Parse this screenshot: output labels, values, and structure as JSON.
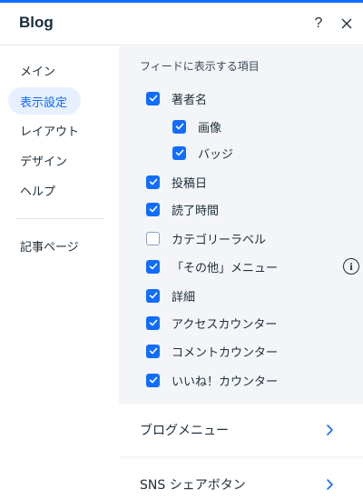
{
  "header": {
    "title": "Blog",
    "help_label": "?"
  },
  "sidebar": {
    "items": [
      {
        "label": "メイン"
      },
      {
        "label": "表示設定"
      },
      {
        "label": "レイアウト"
      },
      {
        "label": "デザイン"
      },
      {
        "label": "ヘルプ"
      },
      {
        "label": "記事ページ"
      }
    ]
  },
  "content": {
    "section_title": "フィードに表示する項目",
    "options": [
      {
        "label": "著者名",
        "checked": true
      },
      {
        "label": "画像",
        "checked": true
      },
      {
        "label": "バッジ",
        "checked": true
      },
      {
        "label": "投稿日",
        "checked": true
      },
      {
        "label": "読了時間",
        "checked": true
      },
      {
        "label": "カテゴリーラベル",
        "checked": false
      },
      {
        "label": "「その他」メニュー",
        "checked": true
      },
      {
        "label": "詳細",
        "checked": true
      },
      {
        "label": "アクセスカウンター",
        "checked": true
      },
      {
        "label": "コメントカウンター",
        "checked": true
      },
      {
        "label": "いいね！カウンター",
        "checked": true
      }
    ],
    "info_label": "i",
    "links": [
      {
        "label": "ブログメニュー"
      },
      {
        "label": "SNS シェアボタン"
      }
    ]
  },
  "colors": {
    "accent": "#116dff",
    "panel_bg": "#f3f5f8",
    "active_bg": "#e7f0ff",
    "text": "#20303c"
  }
}
